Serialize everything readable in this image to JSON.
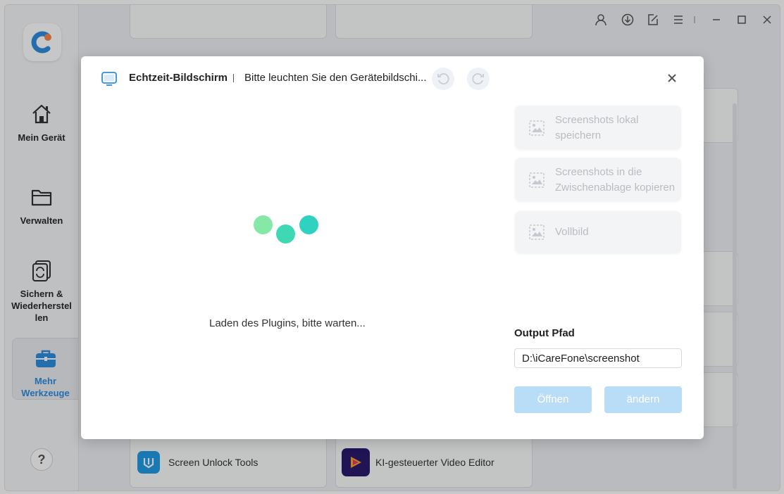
{
  "sidebar": {
    "items": [
      {
        "label": "Mein Gerät",
        "icon": "home-icon"
      },
      {
        "label": "Verwalten",
        "icon": "folder-icon"
      },
      {
        "label": "Sichern & Wiederherstellen",
        "label_lines": [
          "Sichern &",
          "Wiederherstel",
          "len"
        ],
        "icon": "backup-restore-icon"
      },
      {
        "label": "Mehr Werkzeuge",
        "label_lines": [
          "Mehr",
          "Werkzeuge"
        ],
        "icon": "toolbox-icon",
        "active": true
      }
    ],
    "help_label": "?"
  },
  "topbar": {
    "icons": [
      "user-icon",
      "download-icon",
      "feedback-icon",
      "menu-icon",
      "minimize-icon",
      "maximize-icon",
      "close-icon"
    ]
  },
  "background_tools": [
    {
      "label": "Screen Unlock Tools",
      "icon": "screen-unlock-icon"
    },
    {
      "label": "KI-gesteuerter Video Editor",
      "icon": "video-editor-icon"
    }
  ],
  "modal": {
    "title": "Echtzeit-Bildschirm",
    "subtitle": "Bitte leuchten Sie den Gerätebildschi...",
    "loading_text": "Laden des Plugins, bitte warten...",
    "actions": [
      {
        "label_lines": [
          "Screenshots lokal",
          "speichern"
        ],
        "icon": "screenshot-icon"
      },
      {
        "label_lines": [
          "Screenshots in die",
          "Zwischenablage kopieren"
        ],
        "icon": "screenshot-icon"
      },
      {
        "label_lines": [
          "Vollbild"
        ],
        "icon": "screenshot-icon"
      }
    ],
    "output_label": "Output Pfad",
    "output_path": "D:\\iCareFone\\screenshot",
    "open_button": "Öffnen",
    "change_button": "ändern"
  },
  "colors": {
    "accent": "#2d8ee0",
    "button_disabled": "#b9dcf7",
    "dot_green": "#7fe6a8",
    "dot_teal": "#2fd2c0"
  }
}
